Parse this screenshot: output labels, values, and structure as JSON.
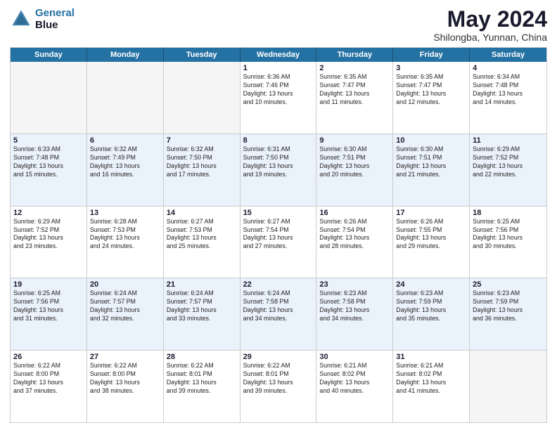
{
  "header": {
    "logo_line1": "General",
    "logo_line2": "Blue",
    "month": "May 2024",
    "location": "Shilongba, Yunnan, China"
  },
  "days": [
    "Sunday",
    "Monday",
    "Tuesday",
    "Wednesday",
    "Thursday",
    "Friday",
    "Saturday"
  ],
  "rows": [
    [
      {
        "day": "",
        "text": ""
      },
      {
        "day": "",
        "text": ""
      },
      {
        "day": "",
        "text": ""
      },
      {
        "day": "1",
        "text": "Sunrise: 6:36 AM\nSunset: 7:46 PM\nDaylight: 13 hours\nand 10 minutes."
      },
      {
        "day": "2",
        "text": "Sunrise: 6:35 AM\nSunset: 7:47 PM\nDaylight: 13 hours\nand 11 minutes."
      },
      {
        "day": "3",
        "text": "Sunrise: 6:35 AM\nSunset: 7:47 PM\nDaylight: 13 hours\nand 12 minutes."
      },
      {
        "day": "4",
        "text": "Sunrise: 6:34 AM\nSunset: 7:48 PM\nDaylight: 13 hours\nand 14 minutes."
      }
    ],
    [
      {
        "day": "5",
        "text": "Sunrise: 6:33 AM\nSunset: 7:48 PM\nDaylight: 13 hours\nand 15 minutes."
      },
      {
        "day": "6",
        "text": "Sunrise: 6:32 AM\nSunset: 7:49 PM\nDaylight: 13 hours\nand 16 minutes."
      },
      {
        "day": "7",
        "text": "Sunrise: 6:32 AM\nSunset: 7:50 PM\nDaylight: 13 hours\nand 17 minutes."
      },
      {
        "day": "8",
        "text": "Sunrise: 6:31 AM\nSunset: 7:50 PM\nDaylight: 13 hours\nand 19 minutes."
      },
      {
        "day": "9",
        "text": "Sunrise: 6:30 AM\nSunset: 7:51 PM\nDaylight: 13 hours\nand 20 minutes."
      },
      {
        "day": "10",
        "text": "Sunrise: 6:30 AM\nSunset: 7:51 PM\nDaylight: 13 hours\nand 21 minutes."
      },
      {
        "day": "11",
        "text": "Sunrise: 6:29 AM\nSunset: 7:52 PM\nDaylight: 13 hours\nand 22 minutes."
      }
    ],
    [
      {
        "day": "12",
        "text": "Sunrise: 6:29 AM\nSunset: 7:52 PM\nDaylight: 13 hours\nand 23 minutes."
      },
      {
        "day": "13",
        "text": "Sunrise: 6:28 AM\nSunset: 7:53 PM\nDaylight: 13 hours\nand 24 minutes."
      },
      {
        "day": "14",
        "text": "Sunrise: 6:27 AM\nSunset: 7:53 PM\nDaylight: 13 hours\nand 25 minutes."
      },
      {
        "day": "15",
        "text": "Sunrise: 6:27 AM\nSunset: 7:54 PM\nDaylight: 13 hours\nand 27 minutes."
      },
      {
        "day": "16",
        "text": "Sunrise: 6:26 AM\nSunset: 7:54 PM\nDaylight: 13 hours\nand 28 minutes."
      },
      {
        "day": "17",
        "text": "Sunrise: 6:26 AM\nSunset: 7:55 PM\nDaylight: 13 hours\nand 29 minutes."
      },
      {
        "day": "18",
        "text": "Sunrise: 6:25 AM\nSunset: 7:56 PM\nDaylight: 13 hours\nand 30 minutes."
      }
    ],
    [
      {
        "day": "19",
        "text": "Sunrise: 6:25 AM\nSunset: 7:56 PM\nDaylight: 13 hours\nand 31 minutes."
      },
      {
        "day": "20",
        "text": "Sunrise: 6:24 AM\nSunset: 7:57 PM\nDaylight: 13 hours\nand 32 minutes."
      },
      {
        "day": "21",
        "text": "Sunrise: 6:24 AM\nSunset: 7:57 PM\nDaylight: 13 hours\nand 33 minutes."
      },
      {
        "day": "22",
        "text": "Sunrise: 6:24 AM\nSunset: 7:58 PM\nDaylight: 13 hours\nand 34 minutes."
      },
      {
        "day": "23",
        "text": "Sunrise: 6:23 AM\nSunset: 7:58 PM\nDaylight: 13 hours\nand 34 minutes."
      },
      {
        "day": "24",
        "text": "Sunrise: 6:23 AM\nSunset: 7:59 PM\nDaylight: 13 hours\nand 35 minutes."
      },
      {
        "day": "25",
        "text": "Sunrise: 6:23 AM\nSunset: 7:59 PM\nDaylight: 13 hours\nand 36 minutes."
      }
    ],
    [
      {
        "day": "26",
        "text": "Sunrise: 6:22 AM\nSunset: 8:00 PM\nDaylight: 13 hours\nand 37 minutes."
      },
      {
        "day": "27",
        "text": "Sunrise: 6:22 AM\nSunset: 8:00 PM\nDaylight: 13 hours\nand 38 minutes."
      },
      {
        "day": "28",
        "text": "Sunrise: 6:22 AM\nSunset: 8:01 PM\nDaylight: 13 hours\nand 39 minutes."
      },
      {
        "day": "29",
        "text": "Sunrise: 6:22 AM\nSunset: 8:01 PM\nDaylight: 13 hours\nand 39 minutes."
      },
      {
        "day": "30",
        "text": "Sunrise: 6:21 AM\nSunset: 8:02 PM\nDaylight: 13 hours\nand 40 minutes."
      },
      {
        "day": "31",
        "text": "Sunrise: 6:21 AM\nSunset: 8:02 PM\nDaylight: 13 hours\nand 41 minutes."
      },
      {
        "day": "",
        "text": ""
      }
    ]
  ]
}
